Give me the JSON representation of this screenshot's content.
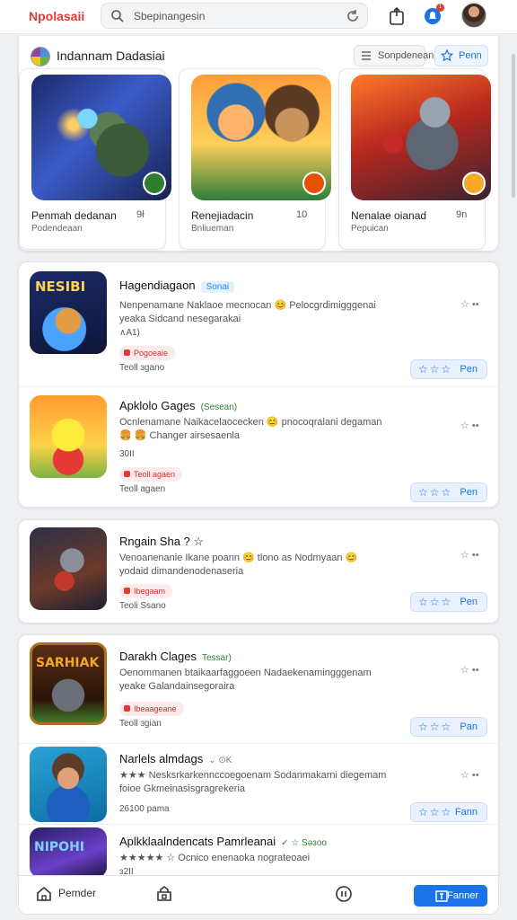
{
  "header": {
    "logo": "Npolasaii",
    "search_placeholder": "Sbepinangesin",
    "notification_count": "1"
  },
  "featured": {
    "title": "Indannam Dadasiai",
    "sort_label": "Sonpdenean",
    "open_label": "Penn",
    "cards": [
      {
        "name": "Penmah dedanan",
        "num": "9ł",
        "sub": "Podendeaan"
      },
      {
        "name": "Renejiadacin",
        "num": "10",
        "sub": "Bnliueman"
      },
      {
        "name": "Nenalae oianad",
        "num": "9n",
        "sub": "Pepuican"
      }
    ]
  },
  "list1": [
    {
      "title": "Hagendiagaon",
      "tag": "Sonai",
      "desc1": "Nenpenamane Naklaoe mecnocan 😊 Pelocgrdimigggenai",
      "desc2": "yeaka Sidcand nesegarakai",
      "meta": "∧A1)",
      "chip": "Pogoeaie",
      "stats": "Teoll ɜgano",
      "action": "Pen",
      "icon_text": "NESIBI"
    },
    {
      "title": "Apklolo Gages",
      "tag": "(Sesean)",
      "desc1": "Ocnlenamane Naikacelaocecken 😊 pnocoqralani degaman",
      "desc2": "🍔 🍔 Changer ɜirsesaenla",
      "meta": "30II",
      "chip": "Teoll agaen",
      "stats": "Teoll agaen",
      "action": "Pen",
      "icon_text": ""
    }
  ],
  "list2": [
    {
      "title": "Rngain Sha ? ☆",
      "desc1": "Venoanenanie Ikane poann 😊 tlono as Nodmyaan 😊",
      "desc2": "yodaid dimandenodenaseria",
      "chip": "Ibegaam",
      "stats": "Teoli Ssano",
      "action": "Pen"
    }
  ],
  "list3": [
    {
      "title": "Darakh Clages",
      "tag": "Tessar)",
      "desc1": "Oenommanen btaikaarfaggoeen Nadaekenamingggenam",
      "desc2": "yeake Galandainsegoraira",
      "chip": "Ibeaageane",
      "stats": "Teoll ɜgian",
      "action": "Pan",
      "icon_text": "SARHIAK"
    },
    {
      "title": "Narlels almdags",
      "tag": "⌄ ⊙K",
      "desc1": "★★★ Nesksrkarkennccoegoenam Sodanmakarni diegemam",
      "desc2": "foioe Gkmeinasisgragrekeria",
      "stats": "26100 pama",
      "action": "Fann"
    },
    {
      "title": "Aplkklaalndencats Pamrleanai",
      "tag": "✓ ☆ Sǝɜoo",
      "desc1": "★★★★★ ☆ Ocnico enenaoka nograteoaei",
      "desc2": "",
      "stats": "ɜ2II",
      "icon_text": "NIPOHI"
    }
  ],
  "bottomnav": {
    "home": "Pemder",
    "active": "Fanner"
  }
}
